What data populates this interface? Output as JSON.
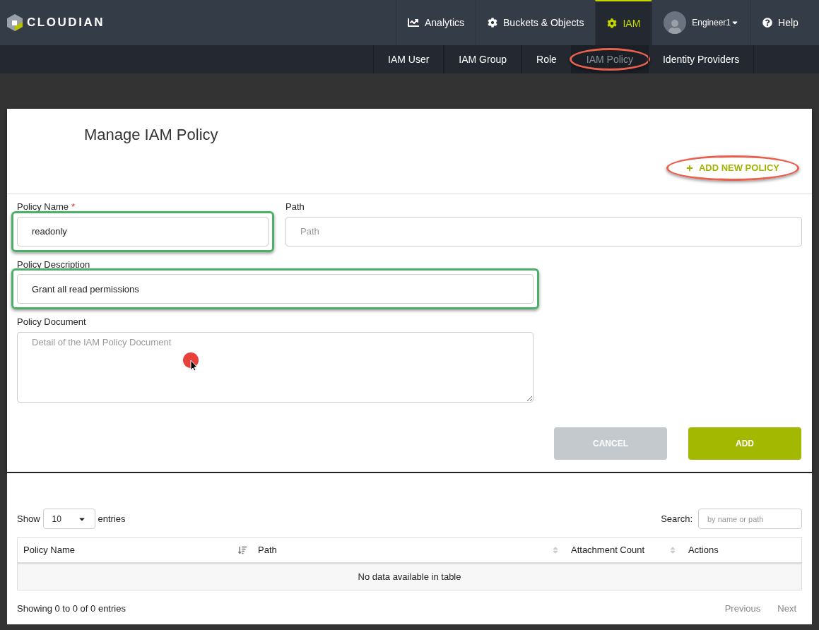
{
  "brand": "CLOUDIAN",
  "top_nav": [
    {
      "label": "Analytics",
      "kind": "chart",
      "selected": false
    },
    {
      "label": "Buckets & Objects",
      "kind": "settings",
      "selected": false
    },
    {
      "label": "IAM",
      "kind": "settings",
      "selected": true
    },
    {
      "label": "Engineer1",
      "kind": "user",
      "selected": false
    },
    {
      "label": "Help",
      "kind": "help",
      "selected": false
    }
  ],
  "sub_nav": [
    {
      "label": "IAM User",
      "selected": false,
      "highlighted": false
    },
    {
      "label": "IAM Group",
      "selected": false,
      "highlighted": false
    },
    {
      "label": "Role",
      "selected": false,
      "highlighted": false
    },
    {
      "label": "IAM Policy",
      "selected": true,
      "highlighted": true
    },
    {
      "label": "Identity Providers",
      "selected": false,
      "highlighted": false
    }
  ],
  "form": {
    "title": "Manage IAM Policy",
    "add_new": {
      "label": "ADD NEW POLICY",
      "highlighted": true
    },
    "policy_name": {
      "label": "Policy Name",
      "required_mark": "*",
      "value": "readonly",
      "highlighted": true
    },
    "path": {
      "label": "Path",
      "placeholder": "Path"
    },
    "policy_description": {
      "label": "Policy Description",
      "value": "Grant all read permissions",
      "highlighted": true
    },
    "policy_document": {
      "label": "Policy Document",
      "placeholder": "Detail of the IAM Policy Document"
    },
    "buttons": [
      {
        "label": "CANCEL",
        "kind": "secondary"
      },
      {
        "label": "ADD",
        "kind": "primary"
      }
    ]
  },
  "table": {
    "show_label": "Show",
    "page_size": "10",
    "entries_label": "entries",
    "search_label": "Search:",
    "search_placeholder": "by name or path",
    "columns": [
      {
        "label": "Policy Name",
        "kind": "sorted"
      },
      {
        "label": "Path",
        "kind": "sortable"
      },
      {
        "label": "Attachment Count",
        "kind": "sortable"
      },
      {
        "label": "Actions",
        "kind": "plain"
      }
    ],
    "empty": "No data available in table",
    "info": "Showing 0 to 0 of 0 entries",
    "pagination": [
      "Previous",
      "Next"
    ]
  }
}
